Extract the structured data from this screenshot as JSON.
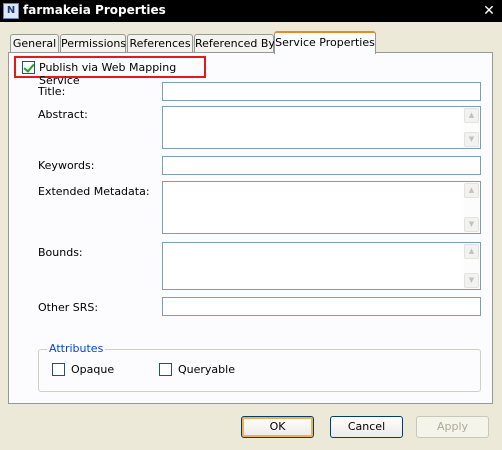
{
  "window": {
    "icon_glyph": "N",
    "title": "farmakeia Properties",
    "close_glyph": "✕"
  },
  "tabs": [
    {
      "label": "General"
    },
    {
      "label": "Permissions"
    },
    {
      "label": "References"
    },
    {
      "label": "Referenced By"
    },
    {
      "label": "Service Properties",
      "active": true
    }
  ],
  "publish": {
    "label": "Publish via Web Mapping Service",
    "checked": true
  },
  "fields": {
    "title": {
      "label": "Title:",
      "value": ""
    },
    "abstract": {
      "label": "Abstract:",
      "value": ""
    },
    "keywords": {
      "label": "Keywords:",
      "value": ""
    },
    "extended_metadata": {
      "label": "Extended Metadata:",
      "value": ""
    },
    "bounds": {
      "label": "Bounds:",
      "value": ""
    },
    "other_srs": {
      "label": "Other SRS:",
      "value": ""
    }
  },
  "attributes": {
    "legend": "Attributes",
    "opaque": {
      "label": "Opaque",
      "checked": false
    },
    "queryable": {
      "label": "Queryable",
      "checked": false
    }
  },
  "buttons": {
    "ok": "OK",
    "cancel": "Cancel",
    "apply": "Apply"
  },
  "colors": {
    "highlight_box": "#e21a1a",
    "active_tab_accent": "#e68b2c",
    "group_legend": "#0046d5"
  }
}
